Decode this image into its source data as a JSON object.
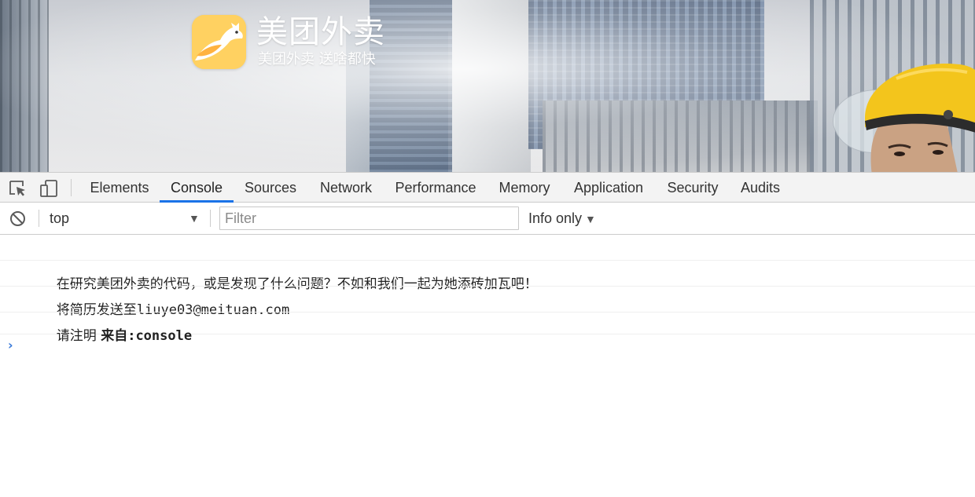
{
  "hero": {
    "brand_title": "美团外卖",
    "brand_slogan": "美团外卖 送啥都快",
    "logo_color": "#ffd161",
    "helmet_color": "#f3c51c"
  },
  "devtools": {
    "tabs": [
      {
        "label": "Elements"
      },
      {
        "label": "Console",
        "active": true
      },
      {
        "label": "Sources"
      },
      {
        "label": "Network"
      },
      {
        "label": "Performance"
      },
      {
        "label": "Memory"
      },
      {
        "label": "Application"
      },
      {
        "label": "Security"
      },
      {
        "label": "Audits"
      }
    ],
    "icons": [
      "inspect-element-icon",
      "device-toolbar-icon",
      "clear-console-icon"
    ],
    "accent_color": "#1a73e8",
    "context_selector": {
      "value": "top"
    },
    "filter": {
      "placeholder": "Filter",
      "value": ""
    },
    "levels": {
      "value": "Info only"
    },
    "console": {
      "messages": [
        {
          "text": "在研究美团外卖的代码，或是发现了什么问题？不如和我们一起为她添砖加瓦吧！"
        },
        {
          "prefix": "将简历发送至",
          "email": "liuye03@meituan.com"
        },
        {
          "prefix": "请注明 ",
          "bold_prefix": "来自",
          "bold_code": ":console"
        }
      ],
      "prompt_color": "#3879d9"
    }
  }
}
